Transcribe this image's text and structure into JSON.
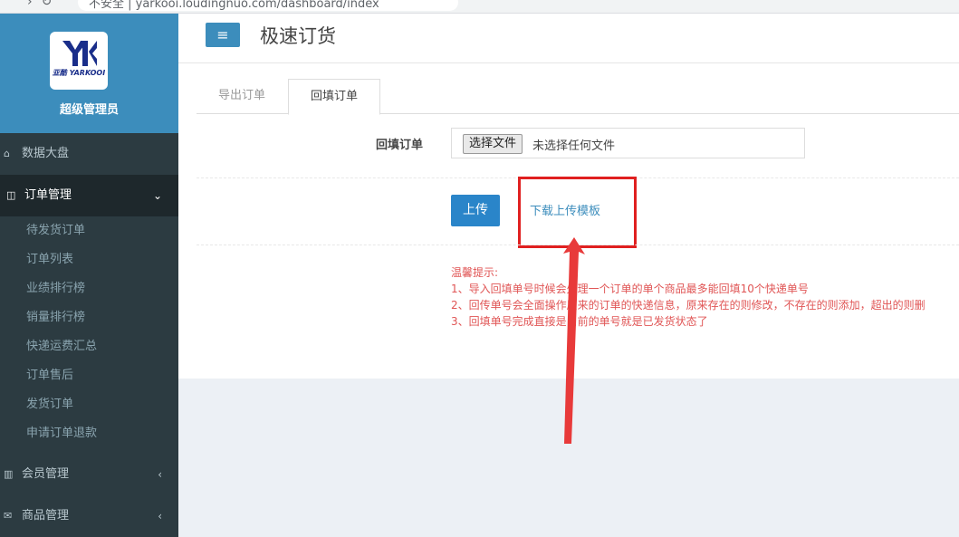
{
  "browser": {
    "url_fragment": "不安全 | yarkooi.loudingnuo.com/dashboard/index"
  },
  "sidebar": {
    "logo_text": "亚酷 YARKOOI",
    "role": "超级管理员",
    "items": [
      {
        "label": "数据大盘",
        "icon": "home-icon"
      },
      {
        "label": "订单管理",
        "icon": "columns-icon",
        "expanded": true,
        "children": [
          "待发货订单",
          "订单列表",
          "业绩排行榜",
          "销量排行榜",
          "快递运费汇总",
          "订单售后",
          "发货订单",
          "申请订单退款"
        ]
      },
      {
        "label": "会员管理",
        "icon": "bar-chart-icon"
      },
      {
        "label": "商品管理",
        "icon": "envelope-icon"
      }
    ]
  },
  "header": {
    "title": "极速订货"
  },
  "tabs": [
    {
      "label": "导出订单",
      "active": false
    },
    {
      "label": "回填订单",
      "active": true
    }
  ],
  "form": {
    "label": "回填订单",
    "file_button": "选择文件",
    "file_status": "未选择任何文件",
    "upload_button": "上传",
    "download_link": "下载上传模板"
  },
  "notice": {
    "title": "温馨提示:",
    "lines": [
      "1、导入回填单号时候会处理一个订单的单个商品最多能回填10个快递单号",
      "2、回传单号会全面操作原来的订单的快递信息，原来存在的则修改，不存在的则添加，超出的则删",
      "3、回填单号完成直接是当前的单号就是已发货状态了"
    ]
  },
  "colors": {
    "accent": "#3c8dbc",
    "sidebar": "#2c3b41",
    "annotation": "#e02020"
  }
}
